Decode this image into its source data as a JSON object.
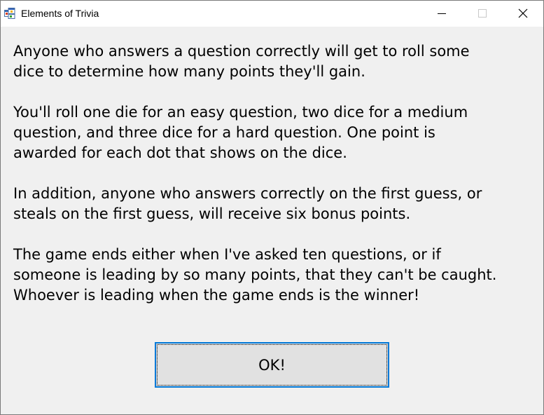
{
  "window": {
    "title": "Elements of Trivia",
    "icon": "application-icon",
    "controls": [
      "minimize-icon",
      "maximize-icon",
      "close-icon"
    ]
  },
  "content": {
    "paragraphs": [
      "Anyone who answers a question correctly will get to roll some\ndice to determine how many points they'll gain.",
      "You'll roll one die for an easy question, two dice for a medium\nquestion, and three dice for a hard question. One point is\nawarded for each dot that shows on the dice.",
      "In addition, anyone who answers correctly on the first guess, or\nsteals on the first guess, will receive six bonus points.",
      "The game ends either when I've asked ten questions, or if\nsomeone is leading by so many points, that they can't be caught.\nWhoever is leading when the game ends is the winner!"
    ]
  },
  "ok_button": {
    "label": "OK!"
  },
  "colors": {
    "title_bar": "#ffffff",
    "client_area": "#f0f0f0",
    "button_face": "#e1e1e1",
    "focus_border": "#0078d7"
  }
}
